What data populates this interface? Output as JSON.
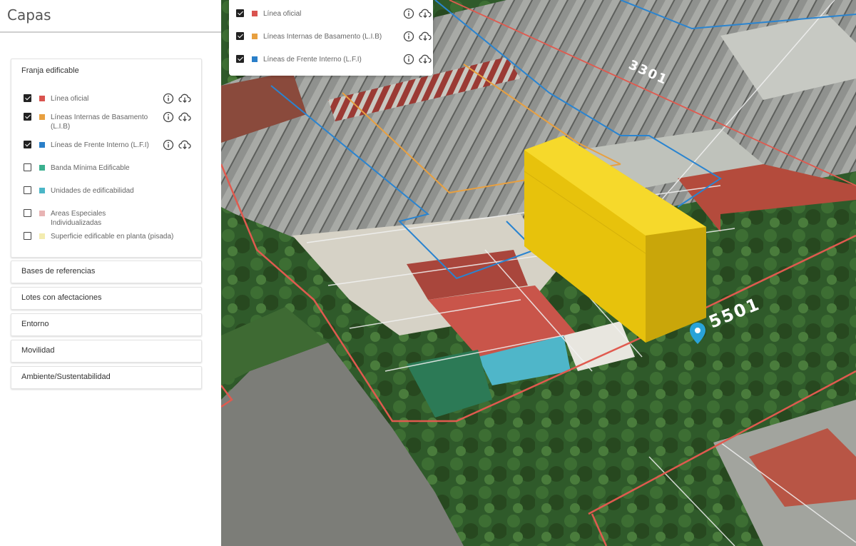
{
  "sidebar": {
    "title": "Capas",
    "group_open": {
      "title": "Franja edificable",
      "layers": [
        {
          "label": "Línea oficial",
          "checked": true,
          "color": "#d9534f",
          "icons": true
        },
        {
          "label": "Líneas Internas de Basamento (L.I.B)",
          "checked": true,
          "color": "#e8a040",
          "icons": true
        },
        {
          "label": "Líneas de Frente Interno (L.F.I)",
          "checked": true,
          "color": "#2a7fc9",
          "icons": true
        },
        {
          "label": "Banda Mínima Edificable",
          "checked": false,
          "color": "#3bb08f",
          "icons": false
        },
        {
          "label": "Unidades de edificabilidad",
          "checked": false,
          "color": "#4bb6c7",
          "icons": false
        },
        {
          "label": "Areas Especiales Individualizadas",
          "checked": false,
          "color": "#e8b4b4",
          "icons": false
        },
        {
          "label": "Superficie edificable en planta (pisada)",
          "checked": false,
          "color": "#f3ecb0",
          "icons": false
        }
      ]
    },
    "groups_collapsed": [
      {
        "title": "Bases de referencias"
      },
      {
        "title": "Lotes con afectaciones"
      },
      {
        "title": "Entorno"
      },
      {
        "title": "Movilidad"
      },
      {
        "title": "Ambiente/Sustentabilidad"
      }
    ]
  },
  "legend": {
    "layers": [
      {
        "label": "Línea oficial",
        "checked": true,
        "color": "#d9534f"
      },
      {
        "label": "Líneas Internas de Basamento (L.I.B)",
        "checked": true,
        "color": "#e8a040"
      },
      {
        "label": "Líneas de Frente Interno (L.F.I)",
        "checked": true,
        "color": "#2a7fc9"
      }
    ]
  },
  "map": {
    "street_numbers": [
      "3301",
      "5501"
    ],
    "building_color": "#f2cc0c",
    "marker_color": "#29a3d8",
    "icons": [
      "info-icon",
      "download-cloud-icon",
      "location-pin-icon"
    ]
  }
}
